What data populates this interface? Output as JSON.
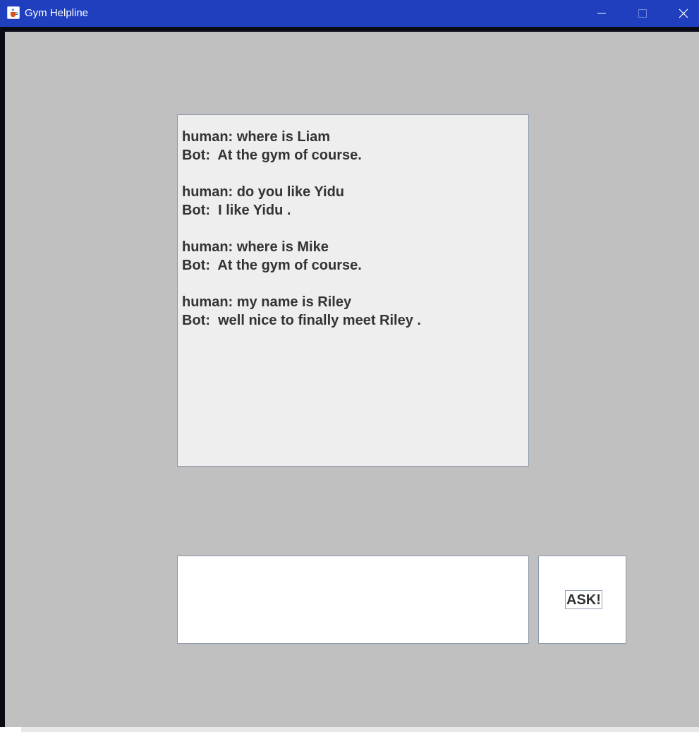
{
  "window": {
    "title": "Gym Helpline",
    "icon": "java-cup-icon",
    "controls": [
      "minimize-icon",
      "maximize-icon",
      "close-icon"
    ]
  },
  "chat": {
    "messages": [
      {
        "human": "human: where is Liam",
        "bot": "Bot:  At the gym of course."
      },
      {
        "human": "human: do you like Yidu",
        "bot": "Bot:  I like Yidu ."
      },
      {
        "human": "human: where is Mike",
        "bot": "Bot:  At the gym of course."
      },
      {
        "human": "human: my name is Riley",
        "bot": "Bot:  well nice to finally meet Riley ."
      }
    ]
  },
  "input": {
    "value": "",
    "placeholder": ""
  },
  "ask_button": {
    "label": "ASK!"
  },
  "colors": {
    "titlebar": "#1f3fbf",
    "background": "#c0c0c0",
    "chat_bg": "#eeeeee",
    "text": "#333333"
  }
}
